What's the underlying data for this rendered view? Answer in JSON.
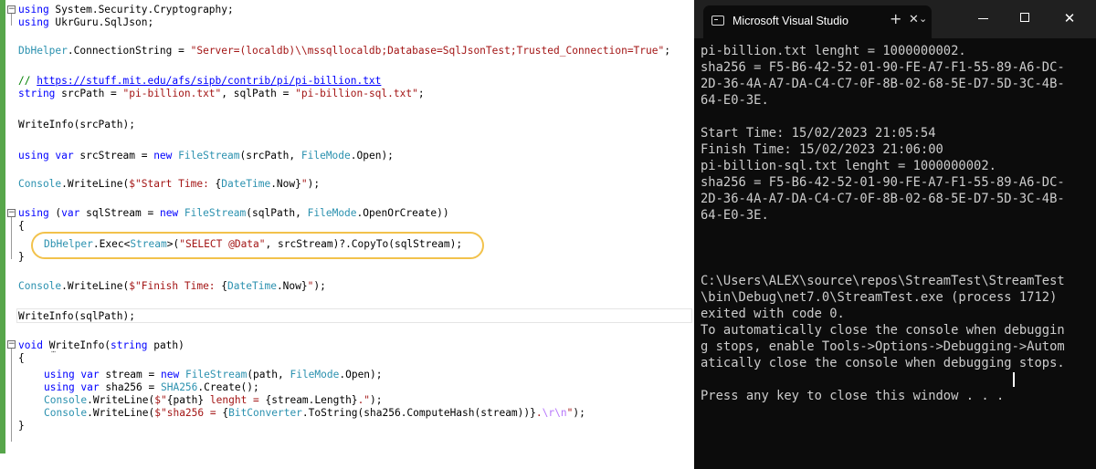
{
  "editor": {
    "lines": [
      [
        [
          "kw",
          "using"
        ],
        [
          "ph",
          " System.Security.Cryptography;"
        ]
      ],
      [
        [
          "kw",
          "using"
        ],
        [
          "ph",
          " UkrGuru.SqlJson;"
        ]
      ],
      [
        [
          "ty",
          "DbHelper"
        ],
        [
          "ph",
          ".ConnectionString = "
        ],
        [
          "st",
          "\"Server=(localdb)\\\\mssqllocaldb;Database=SqlJsonTest;Trusted_Connection=True\""
        ],
        [
          "ph",
          ";"
        ]
      ],
      [
        [
          "cm",
          "// "
        ],
        [
          "lk",
          "https://stuff.mit.edu/afs/sipb/contrib/pi/pi-billion.txt"
        ]
      ],
      [
        [
          "kw",
          "string"
        ],
        [
          "ph",
          " srcPath = "
        ],
        [
          "st",
          "\"pi-billion.txt\""
        ],
        [
          "ph",
          ", sqlPath = "
        ],
        [
          "st",
          "\"pi-billion-sql.txt\""
        ],
        [
          "ph",
          ";"
        ]
      ],
      [
        [
          "ph",
          "WriteInfo(srcPath);"
        ]
      ],
      [
        [
          "kw",
          "using var"
        ],
        [
          "ph",
          " srcStream = "
        ],
        [
          "kw",
          "new"
        ],
        [
          "ph",
          " "
        ],
        [
          "ty",
          "FileStream"
        ],
        [
          "ph",
          "(srcPath, "
        ],
        [
          "ty",
          "FileMode"
        ],
        [
          "ph",
          ".Open);"
        ]
      ],
      [
        [
          "ty",
          "Console"
        ],
        [
          "ph",
          ".WriteLine("
        ],
        [
          "st",
          "$\"Start Time: "
        ],
        [
          "ph",
          "{"
        ],
        [
          "ty",
          "DateTime"
        ],
        [
          "ph",
          ".Now}"
        ],
        [
          "st",
          "\""
        ],
        [
          "ph",
          ");"
        ]
      ],
      [
        [
          "kw",
          "using"
        ],
        [
          "ph",
          " ("
        ],
        [
          "kw",
          "var"
        ],
        [
          "ph",
          " sqlStream = "
        ],
        [
          "kw",
          "new"
        ],
        [
          "ph",
          " "
        ],
        [
          "ty",
          "FileStream"
        ],
        [
          "ph",
          "(sqlPath, "
        ],
        [
          "ty",
          "FileMode"
        ],
        [
          "ph",
          ".OpenOrCreate))"
        ]
      ],
      [
        [
          "ph",
          "{"
        ]
      ],
      [
        [
          "ty",
          "DbHelper"
        ],
        [
          "ph",
          ".Exec<"
        ],
        [
          "ty",
          "Stream"
        ],
        [
          "ph",
          ">("
        ],
        [
          "st",
          "\"SELECT @Data\""
        ],
        [
          "ph",
          ", srcStream)?.CopyTo(sqlStream);"
        ]
      ],
      [
        [
          "ph",
          "}"
        ]
      ],
      [
        [
          "ty",
          "Console"
        ],
        [
          "ph",
          ".WriteLine("
        ],
        [
          "st",
          "$\"Finish Time: "
        ],
        [
          "ph",
          "{"
        ],
        [
          "ty",
          "DateTime"
        ],
        [
          "ph",
          ".Now}"
        ],
        [
          "st",
          "\""
        ],
        [
          "ph",
          ");"
        ]
      ],
      [
        [
          "ph",
          "WriteInfo(sqlPath);"
        ]
      ],
      [
        [
          "kw",
          "void"
        ],
        [
          "ph",
          " WriteInfo("
        ],
        [
          "kw",
          "string"
        ],
        [
          "ph",
          " path)"
        ]
      ],
      [
        [
          "ph",
          "{"
        ]
      ],
      [
        [
          "kw",
          "using var"
        ],
        [
          "ph",
          " stream = "
        ],
        [
          "kw",
          "new"
        ],
        [
          "ph",
          " "
        ],
        [
          "ty",
          "FileStream"
        ],
        [
          "ph",
          "(path, "
        ],
        [
          "ty",
          "FileMode"
        ],
        [
          "ph",
          ".Open);"
        ]
      ],
      [
        [
          "kw",
          "using var"
        ],
        [
          "ph",
          " sha256 = "
        ],
        [
          "ty",
          "SHA256"
        ],
        [
          "ph",
          ".Create();"
        ]
      ],
      [
        [
          "ty",
          "Console"
        ],
        [
          "ph",
          ".WriteLine("
        ],
        [
          "st",
          "$\""
        ],
        [
          "ph",
          "{path}"
        ],
        [
          "st",
          " lenght = "
        ],
        [
          "ph",
          "{stream.Length}"
        ],
        [
          "st",
          ".\""
        ],
        [
          "ph",
          ");"
        ]
      ],
      [
        [
          "ty",
          "Console"
        ],
        [
          "ph",
          ".WriteLine("
        ],
        [
          "st",
          "$\"sha256 = "
        ],
        [
          "ph",
          "{"
        ],
        [
          "ty",
          "BitConverter"
        ],
        [
          "ph",
          ".ToString(sha256.ComputeHash(stream))}"
        ],
        [
          "st",
          "."
        ],
        [
          "es",
          "\\r\\n"
        ],
        [
          "st",
          "\""
        ],
        [
          "ph",
          ");"
        ]
      ],
      [
        [
          "ph",
          "}"
        ]
      ]
    ]
  },
  "console": {
    "tab_title": "Microsoft Visual Studio",
    "tab_close": "✕",
    "new_tab": "+",
    "dropdown": "⌄",
    "close_glyph": "✕",
    "lines": [
      "pi-billion.txt lenght = 1000000002.",
      "sha256 = F5-B6-42-52-01-90-FE-A7-F1-55-89-A6-DC-",
      "2D-36-4A-A7-DA-C4-C7-0F-8B-02-68-5E-D7-5D-3C-4B-",
      "64-E0-3E.",
      "",
      "Start Time: 15/02/2023 21:05:54",
      "Finish Time: 15/02/2023 21:06:00",
      "pi-billion-sql.txt lenght = 1000000002.",
      "sha256 = F5-B6-42-52-01-90-FE-A7-F1-55-89-A6-DC-",
      "2D-36-4A-A7-DA-C4-C7-0F-8B-02-68-5E-D7-5D-3C-4B-",
      "64-E0-3E.",
      "",
      "",
      "",
      "C:\\Users\\ALEX\\source\\repos\\StreamTest\\StreamTest",
      "\\bin\\Debug\\net7.0\\StreamTest.exe (process 1712)",
      "exited with code 0.",
      "To automatically close the console when debuggin",
      "g stops, enable Tools->Options->Debugging->Autom",
      "atically close the console when debugging stops.",
      "",
      "Press any key to close this window . . ."
    ]
  },
  "colors": {
    "keyword": "#0000ff",
    "type": "#2b91af",
    "string": "#a31515",
    "comment": "#008000",
    "console_bg": "#0c0c0c",
    "highlight": "#f2c24c"
  }
}
